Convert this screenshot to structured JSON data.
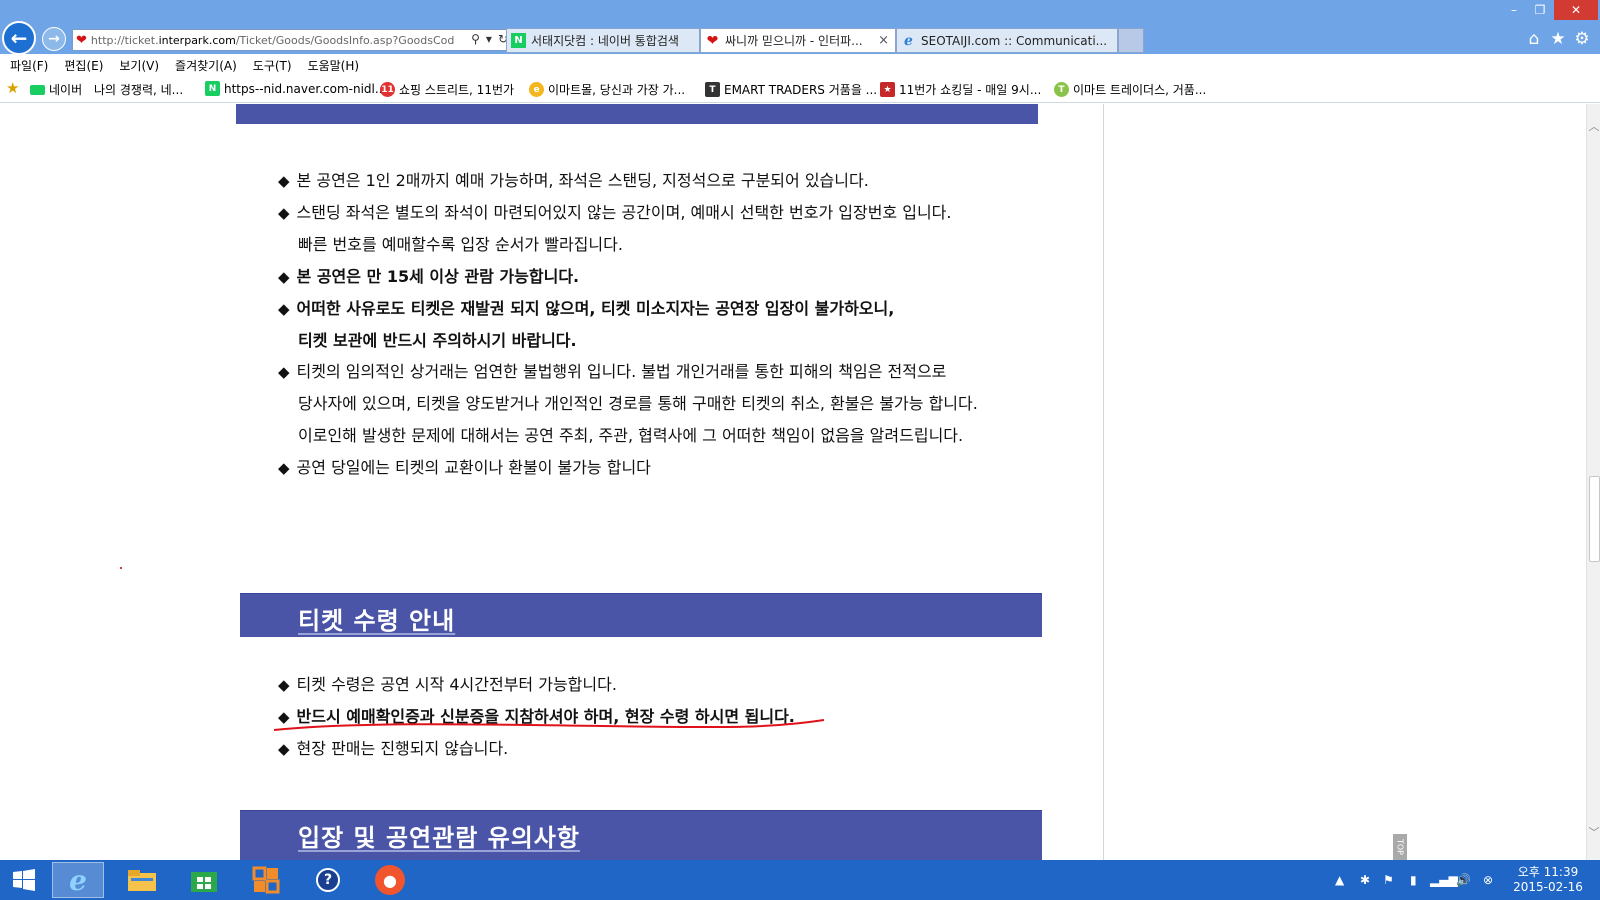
{
  "browser": {
    "address_url": "http://ticket.interpark.com/Ticket/Goods/GoodsInfo.asp?GoodsCod",
    "address_prefix": "http://ticket.",
    "address_host": "interpark.com",
    "address_path": "/Ticket/Goods/GoodsInfo.asp?GoodsCod",
    "tabs": [
      {
        "label": "서태지닷컴 : 네이버 통합검색",
        "icon": "naver-icon",
        "active": false
      },
      {
        "label": "싸니까 믿으니까 - 인터파...",
        "icon": "interpark-heart-icon",
        "active": true
      },
      {
        "label": "SEOTAIJI.com :: Communicati...",
        "icon": "ie-icon",
        "active": false
      }
    ],
    "tab_close_glyph": "×"
  },
  "menu": {
    "items": [
      "파일(F)",
      "편집(E)",
      "보기(V)",
      "즐겨찾기(A)",
      "도구(T)",
      "도움말(H)"
    ]
  },
  "favorites": {
    "items": [
      {
        "label": "네이버",
        "icon": "naver-green-icon",
        "color": "#19ce60"
      },
      {
        "label": "나의 경쟁력, 네...",
        "icon": "",
        "color": ""
      },
      {
        "label": "https--nid.naver.com-nidl...",
        "icon": "naver-n-icon",
        "color": "#19ce60"
      },
      {
        "label": "쇼핑 스트리트, 11번가",
        "icon": "11st-icon",
        "color": "#e23131"
      },
      {
        "label": "이마트몰, 당신과 가장 가...",
        "icon": "emart-icon",
        "color": "#f3b61f"
      },
      {
        "label": "EMART TRADERS 거품을 ...",
        "icon": "traders-icon",
        "color": "#333333"
      },
      {
        "label": "11번가 쇼킹딜 - 매일 9시...",
        "icon": "shockingdeal-icon",
        "color": "#c62828"
      },
      {
        "label": "이마트 트레이더스, 거품...",
        "icon": "traders-t-icon",
        "color": "#8bc34a"
      }
    ]
  },
  "content": {
    "section1_bullets": [
      {
        "text": "본 공연은 1인 2매까지 예매 가능하며, 좌석은 스탠딩, 지정석으로 구분되어 있습니다.",
        "bold": false,
        "bullet": true
      },
      {
        "text": "스탠딩 좌석은 별도의 좌석이 마련되어있지 않는 공간이며, 예매시 선택한 번호가 입장번호 입니다.",
        "bold": false,
        "bullet": true
      },
      {
        "text": "빠른 번호를 예매할수록 입장 순서가 빨라집니다.",
        "bold": false,
        "bullet": false
      },
      {
        "text": "본 공연은 만 15세 이상 관람 가능합니다.",
        "bold": true,
        "bullet": true
      },
      {
        "text": "어떠한 사유로도 티켓은 재발권 되지 않으며, 티켓 미소지자는 공연장 입장이 불가하오니,",
        "bold": true,
        "bullet": true
      },
      {
        "text": "티켓 보관에 반드시 주의하시기 바랍니다.",
        "bold": true,
        "bullet": false
      },
      {
        "text": "티켓의 임의적인 상거래는 엄연한 불법행위 입니다. 불법 개인거래를 통한 피해의 책임은 전적으로",
        "bold": false,
        "bullet": true
      },
      {
        "text": "당사자에 있으며, 티켓을 양도받거나 개인적인 경로를 통해 구매한 티켓의 취소, 환불은 불가능 합니다.",
        "bold": false,
        "bullet": false
      },
      {
        "text": "이로인해 발생한 문제에 대해서는 공연 주최, 주관, 협력사에 그 어떠한 책임이 없음을 알려드립니다.",
        "bold": false,
        "bullet": false
      },
      {
        "text": "공연 당일에는 티켓의 교환이나 환불이 불가능 합니다",
        "bold": false,
        "bullet": true
      }
    ],
    "section2_title": "티켓 수령 안내",
    "section2_bullets": [
      {
        "text": "티켓 수령은 공연 시작 4시간전부터 가능합니다.",
        "bold": false
      },
      {
        "text": "반드시 예매확인증과 신분증을 지참하셔야 하며, 현장 수령 하시면 됩니다.",
        "bold": true
      },
      {
        "text": "현장 판매는 진행되지 않습니다.",
        "bold": false
      }
    ],
    "section3_title": "입장 및 공연관람 유의사항",
    "bullet_glyph": "◆",
    "underline_color": "#e0121b",
    "section_color": "#4b55a7"
  },
  "side_tab_label": "TOP",
  "taskbar": {
    "apps": [
      "ie-icon",
      "file-explorer-icon",
      "store-icon",
      "office-icon",
      "help-icon",
      "gom-icon"
    ],
    "clock_period_time": "오후 11:39",
    "clock_date": "2015-02-16"
  }
}
